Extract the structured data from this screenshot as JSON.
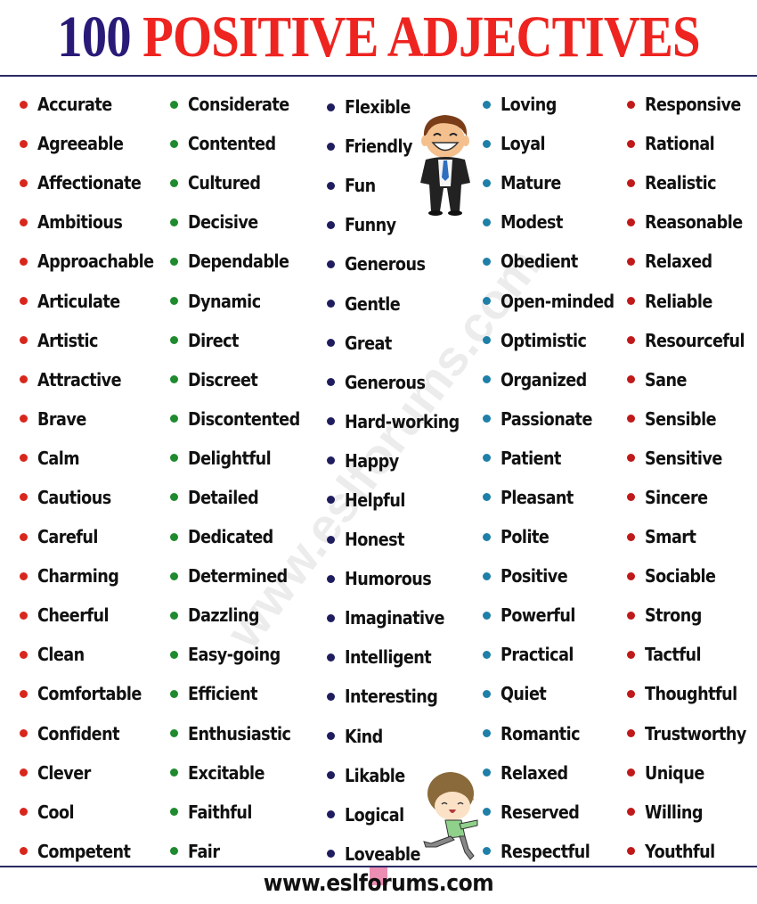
{
  "header": {
    "title_number": "100",
    "title_text": "POSITIVE ADJECTIVES"
  },
  "watermark": "www.eslforums.com",
  "footer": {
    "url": "www.eslforums.com"
  },
  "colors": {
    "title_number": "#2a1a78",
    "title_text": "#ee2420",
    "rule": "#2b2a63",
    "bullet_col1": "#d9261c",
    "bullet_col2": "#1f8a2e",
    "bullet_col3": "#1f1d5e",
    "bullet_col4": "#1e7fa8",
    "bullet_col5": "#c0191a"
  },
  "illustrations": [
    {
      "name": "smiling-businessman",
      "description": "cartoon man in suit with blue tie"
    },
    {
      "name": "running-boy",
      "description": "cartoon boy in green shirt running"
    }
  ],
  "columns": [
    {
      "bullet_color": "#d9261c",
      "words": [
        "Accurate",
        "Agreeable",
        "Affectionate",
        "Ambitious",
        "Approachable",
        "Articulate",
        "Artistic",
        "Attractive",
        "Brave",
        "Calm",
        "Cautious",
        "Careful",
        "Charming",
        "Cheerful",
        "Clean",
        "Comfortable",
        "Confident",
        "Clever",
        "Cool",
        "Competent"
      ]
    },
    {
      "bullet_color": "#1f8a2e",
      "words": [
        "Considerate",
        "Contented",
        "Cultured",
        "Decisive",
        "Dependable",
        "Dynamic",
        "Direct",
        "Discreet",
        "Discontented",
        "Delightful",
        "Detailed",
        "Dedicated",
        "Determined",
        "Dazzling",
        "Easy-going",
        "Efficient",
        "Enthusiastic",
        "Excitable",
        "Faithful",
        "Fair"
      ]
    },
    {
      "bullet_color": "#1f1d5e",
      "words": [
        "Flexible",
        "Friendly",
        "Fun",
        "Funny",
        "Generous",
        "Gentle",
        "Great",
        "Generous",
        "Hard-working",
        "Happy",
        "Helpful",
        "Honest",
        "Humorous",
        "Imaginative",
        "Intelligent",
        "Interesting",
        "Kind",
        "Likable",
        "Logical",
        "Loveable"
      ]
    },
    {
      "bullet_color": "#1e7fa8",
      "words": [
        "Loving",
        "Loyal",
        "Mature",
        "Modest",
        "Obedient",
        "Open-minded",
        "Optimistic",
        "Organized",
        "Passionate",
        "Patient",
        "Pleasant",
        "Polite",
        "Positive",
        "Powerful",
        "Practical",
        "Quiet",
        "Romantic",
        "Relaxed",
        "Reserved",
        "Respectful"
      ]
    },
    {
      "bullet_color": "#c0191a",
      "words": [
        "Responsive",
        "Rational",
        "Realistic",
        "Reasonable",
        "Relaxed",
        "Reliable",
        "Resourceful",
        "Sane",
        "Sensible",
        "Sensitive",
        "Sincere",
        "Smart",
        "Sociable",
        "Strong",
        "Tactful",
        "Thoughtful",
        "Trustworthy",
        "Unique",
        "Willing",
        "Youthful"
      ]
    }
  ]
}
